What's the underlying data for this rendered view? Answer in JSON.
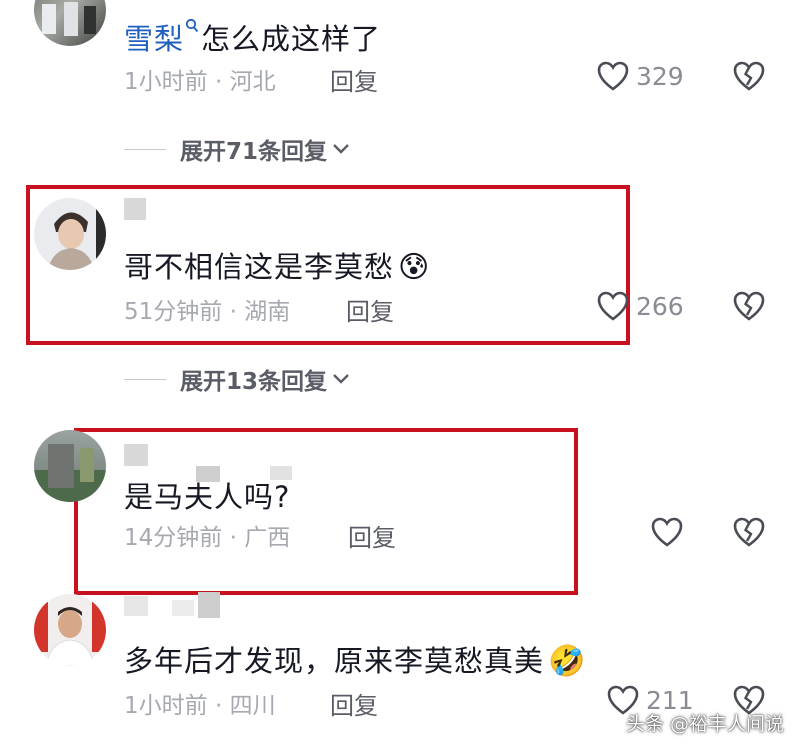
{
  "comments": [
    {
      "username": "雪梨",
      "text": "怎么成这样了",
      "time": "1小时前",
      "location": "河北",
      "reply": "回复",
      "likes": "329"
    },
    {
      "text": "哥不相信这是李莫愁",
      "emoji": "😰",
      "time": "51分钟前",
      "location": "湖南",
      "reply": "回复",
      "likes": "266"
    },
    {
      "text": "是马夫人吗?",
      "time": "14分钟前",
      "location": "广西",
      "reply": "回复"
    },
    {
      "text": "多年后才发现，原来李莫愁真美",
      "emoji": "🤣",
      "time": "1小时前",
      "location": "四川",
      "reply": "回复",
      "likes": "211"
    }
  ],
  "expand_replies": [
    {
      "label": "展开71条回复"
    },
    {
      "label": "展开13条回复"
    }
  ],
  "separator": " · ",
  "watermark": "头条 @裕丰人间说",
  "icons": {
    "like": "heart-outline-icon",
    "dislike": "broken-heart-icon",
    "chevron": "chevron-down-icon",
    "search": "search-icon"
  },
  "colors": {
    "highlight_box": "#c8101e",
    "mention": "#1f5fbf",
    "meta": "#a7a9b0"
  }
}
